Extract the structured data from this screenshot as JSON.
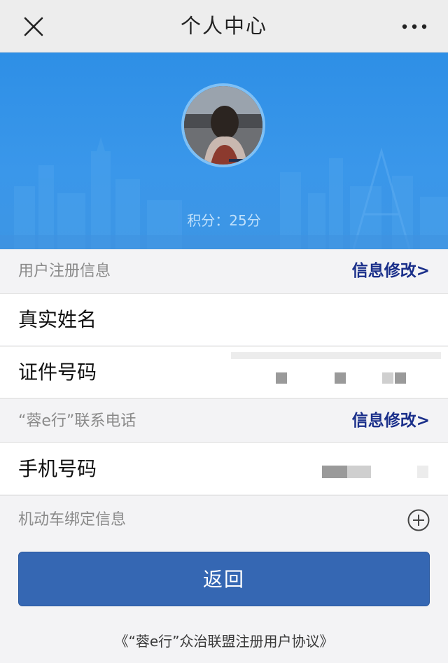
{
  "navbar": {
    "title": "个人中心",
    "close_icon": "close-icon",
    "more_icon": "more-icon"
  },
  "banner": {
    "points_text": "积分：25分",
    "background_color": "#3a97ea"
  },
  "sections": {
    "registration": {
      "label": "用户注册信息",
      "edit_label": "信息修改>",
      "rows": [
        {
          "label": "真实姓名"
        },
        {
          "label": "证件号码"
        }
      ]
    },
    "phone": {
      "label": "“蓉e行”联系电话",
      "edit_label": "信息修改>",
      "rows": [
        {
          "label": "手机号码"
        }
      ]
    },
    "vehicle": {
      "label": "机动车绑定信息",
      "add_icon": "plus-circle-icon"
    }
  },
  "back_button": {
    "label": "返回",
    "color": "#3567b3"
  },
  "agreement": {
    "text": "《“蓉e行”众治联盟注册用户协议》"
  },
  "colors": {
    "edit_link": "#1a2f8a",
    "muted_text": "#8a8a8a"
  }
}
